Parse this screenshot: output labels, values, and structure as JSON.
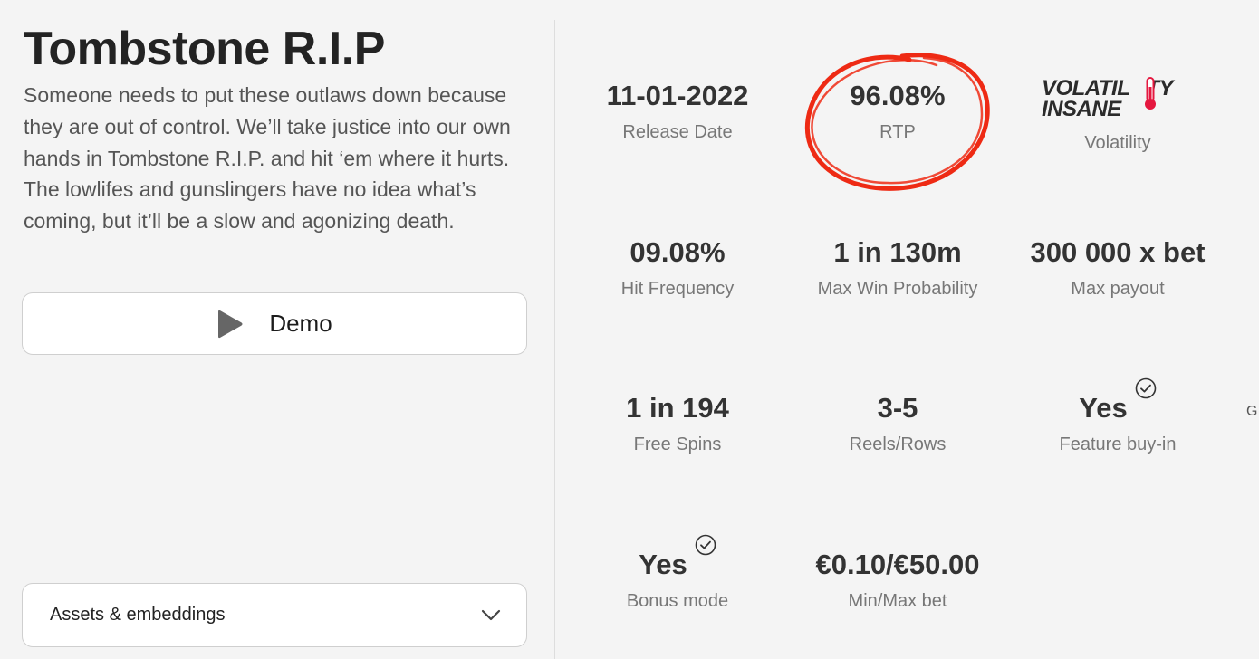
{
  "game": {
    "title": "Tombstone R.I.P",
    "description": "Someone needs to put these outlaws down because they are out of control. We’ll take justice into our own hands in Tombstone R.I.P. and hit ‘em where it hurts. The lowlifes and gunslingers have no idea what’s coming, but it’ll be a slow and agonizing death."
  },
  "actions": {
    "demo_label": "Demo",
    "demo_icon": "play-icon",
    "assets_label": "Assets & embeddings",
    "assets_icon": "chevron-down-icon"
  },
  "stats": {
    "release": {
      "value": "11-01-2022",
      "label": "Release Date"
    },
    "rtp": {
      "value": "96.08%",
      "label": "RTP",
      "highlight_color": "#ee2a14"
    },
    "volatility": {
      "logo_line1": "VOLATILITY",
      "logo_line2": "INSANE",
      "label": "Volatility",
      "icon": "thermometer-icon",
      "icon_color": "#e5173f"
    },
    "hit_frequency": {
      "value": "09.08%",
      "label": "Hit Frequency"
    },
    "max_win_probability": {
      "value": "1 in 130m",
      "label": "Max Win Probability"
    },
    "max_payout": {
      "value": "300 000 x bet",
      "label": "Max payout"
    },
    "free_spins": {
      "value": "1 in 194",
      "label": "Free Spins"
    },
    "reels_rows": {
      "value": "3-5",
      "label": "Reels/Rows"
    },
    "feature_buy_in": {
      "value": "Yes",
      "label": "Feature buy-in",
      "icon": "check-circle-icon"
    },
    "bonus_mode": {
      "value": "Yes",
      "label": "Bonus mode",
      "icon": "check-circle-icon"
    },
    "min_max_bet": {
      "value": "€0.10/€50.00",
      "label": "Min/Max bet"
    }
  },
  "clipped_edge_text": "G"
}
